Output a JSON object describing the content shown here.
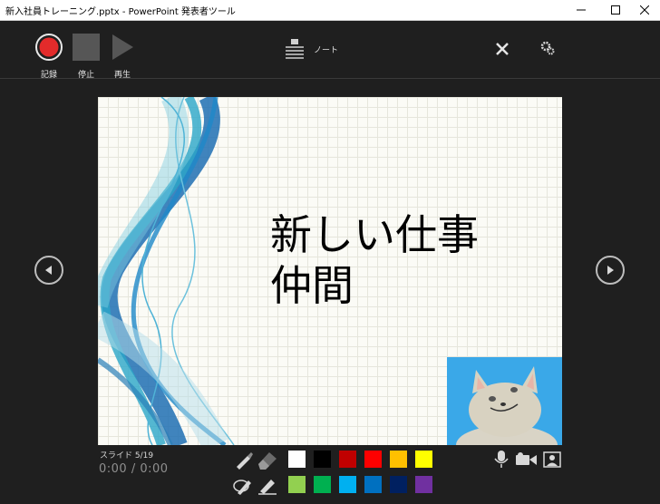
{
  "window": {
    "title": "新入社員トレーニング.pptx - PowerPoint 発表者ツール"
  },
  "toolbar": {
    "record_label": "記録",
    "stop_label": "停止",
    "play_label": "再生",
    "notes_label": "ノート"
  },
  "slide": {
    "title_line1": "新しい仕事",
    "title_line2": "仲間"
  },
  "status": {
    "slide_counter": "スライド 5/19",
    "timer": "0:00 / 0:00"
  },
  "colors": {
    "row1": [
      "#ffffff",
      "#000000",
      "#c00000",
      "#ff0000",
      "#ffc000",
      "#ffff00"
    ],
    "row2": [
      "#92d050",
      "#00b050",
      "#00b0f0",
      "#0070c0",
      "#002060",
      "#7030a0"
    ]
  },
  "icons": [
    "record-icon",
    "stop-icon",
    "play-icon",
    "notes-icon",
    "close-icon",
    "settings-icon",
    "prev-slide-icon",
    "next-slide-icon",
    "pen-icon",
    "eraser-icon",
    "lasso-icon",
    "highlighter-icon",
    "microphone-icon",
    "camera-icon",
    "presenter-view-icon"
  ]
}
